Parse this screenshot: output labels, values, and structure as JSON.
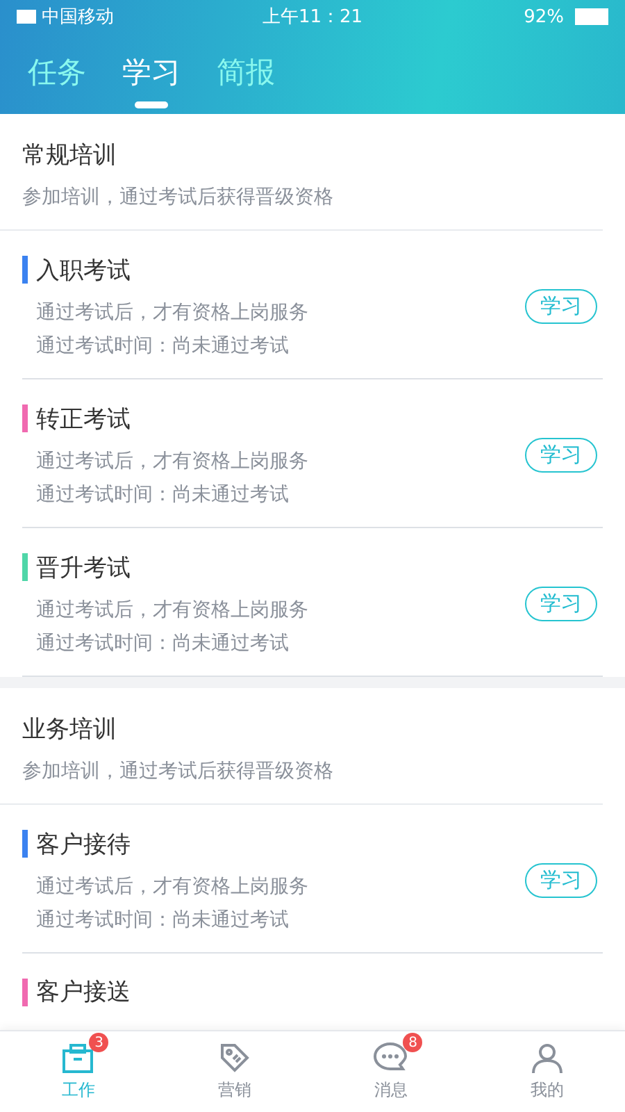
{
  "status_bar": {
    "carrier": "中国移动",
    "time": "上午11：21",
    "battery": "92%"
  },
  "tabs": [
    {
      "label": "任务",
      "selected": false
    },
    {
      "label": "学习",
      "selected": true
    },
    {
      "label": "简报",
      "selected": false
    }
  ],
  "sections": [
    {
      "title": "常规培训",
      "subtitle": "参加培训，通过考试后获得晋级资格",
      "items": [
        {
          "title": "入职考试",
          "color": "#3b82f0",
          "desc": "通过考试后，才有资格上岗服务",
          "status": "通过考试时间：尚未通过考试",
          "button": "学习"
        },
        {
          "title": "转正考试",
          "color": "#f06ab0",
          "desc": "通过考试后，才有资格上岗服务",
          "status": "通过考试时间：尚未通过考试",
          "button": "学习"
        },
        {
          "title": "晋升考试",
          "color": "#4fd6a8",
          "desc": "通过考试后，才有资格上岗服务",
          "status": "通过考试时间：尚未通过考试",
          "button": "学习"
        }
      ]
    },
    {
      "title": "业务培训",
      "subtitle": "参加培训，通过考试后获得晋级资格",
      "items": [
        {
          "title": "客户接待",
          "color": "#3b82f0",
          "desc": "通过考试后，才有资格上岗服务",
          "status": "通过考试时间：尚未通过考试",
          "button": "学习"
        },
        {
          "title": "客户接送",
          "color": "#f06ab0"
        }
      ]
    }
  ],
  "bottom_nav": [
    {
      "kind": "work",
      "label": "工作",
      "selected": true,
      "badge": "3"
    },
    {
      "kind": "marketing",
      "label": "营销",
      "selected": false
    },
    {
      "kind": "messages",
      "label": "消息",
      "selected": false,
      "badge": "8"
    },
    {
      "kind": "profile",
      "label": "我的",
      "selected": false
    }
  ]
}
